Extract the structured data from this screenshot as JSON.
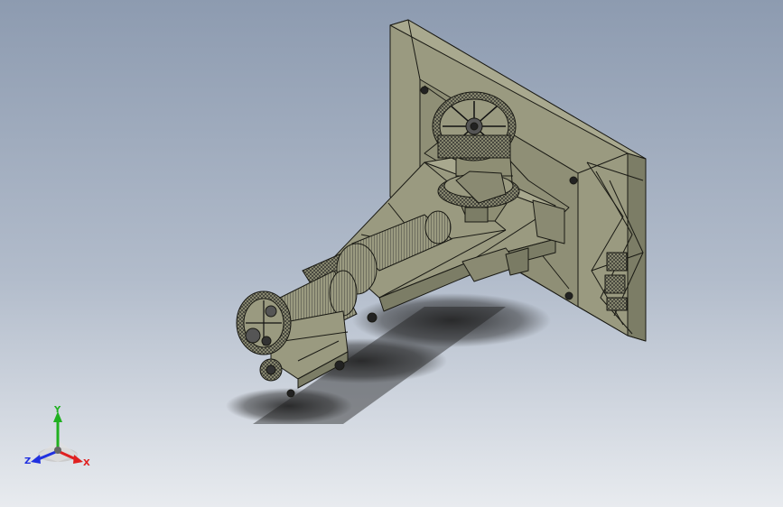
{
  "viewport": {
    "background_top": "#8d9bb0",
    "background_bottom": "#e8ebef",
    "model_color": "#9a9a80",
    "model_shadow_color": "#6f705c",
    "edge_color": "#1a1a14"
  },
  "triad": {
    "x_label": "X",
    "y_label": "Y",
    "z_label": "Z",
    "x_color": "#e02020",
    "y_color": "#20b020",
    "z_color": "#2030e0"
  }
}
